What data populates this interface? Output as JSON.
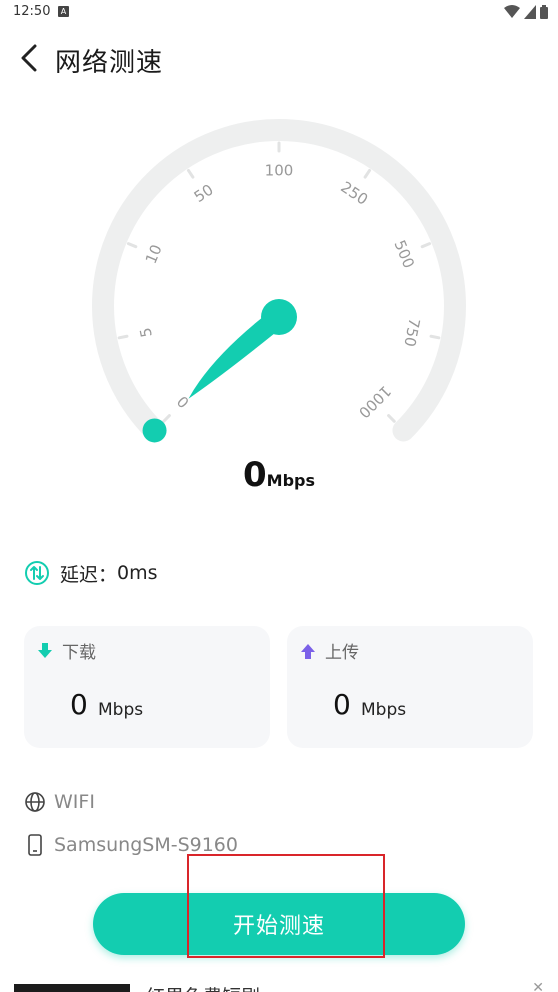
{
  "status_bar": {
    "time": "12:50",
    "notification_icon": "A"
  },
  "header": {
    "title": "网络测速",
    "back_icon": "chevron-left-icon"
  },
  "gauge": {
    "ticks": [
      "0",
      "5",
      "10",
      "50",
      "100",
      "250",
      "500",
      "750",
      "1000"
    ],
    "current_value": 0,
    "accent_color": "#13cdb0",
    "track_color": "#eeefef"
  },
  "speed": {
    "value": "0",
    "unit": "Mbps"
  },
  "latency": {
    "label": "延迟：",
    "value": "0ms"
  },
  "download": {
    "label": "下载",
    "value": "0",
    "unit": "Mbps",
    "icon_color": "#13cdb0"
  },
  "upload": {
    "label": "上传",
    "value": "0",
    "unit": "Mbps",
    "icon_color": "#7b61e8"
  },
  "network": {
    "type": "WIFI",
    "device": "SamsungSM-S9160"
  },
  "action": {
    "start_label": "开始测速"
  },
  "ad": {
    "text": "红果免费短剧"
  }
}
